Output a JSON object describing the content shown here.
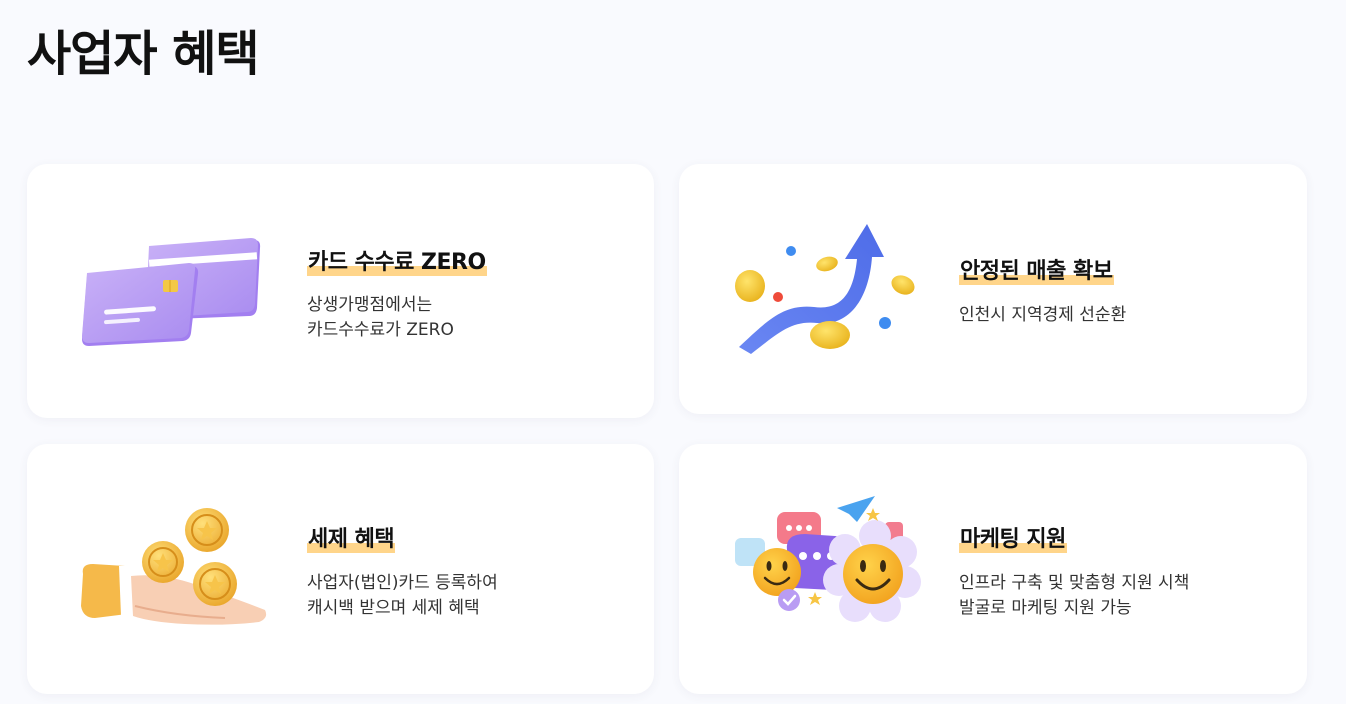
{
  "page": {
    "title": "사업자 혜택"
  },
  "cards": [
    {
      "title": "카드 수수료 ZERO",
      "desc": "상생가맹점에서는\n카드수수료가 ZERO",
      "icon": "credit-card-icon"
    },
    {
      "title": "안정된 매출 확보",
      "desc": "인천시 지역경제 선순환",
      "icon": "growth-arrow-coins-icon"
    },
    {
      "title": "세제 혜택",
      "desc": "사업자(법인)카드 등록하여\n캐시백 받으며 세제 혜택",
      "icon": "hand-coins-icon"
    },
    {
      "title": "마케팅 지원",
      "desc": "인프라 구축 및 맞춤형 지원 시책\n발굴로 마케팅 지원 가능",
      "icon": "smiley-chat-icon"
    }
  ],
  "colors": {
    "highlight": "#ffd58a",
    "card_purple": "#b79cf5",
    "arrow_blue": "#5b7cf0",
    "coin_yellow": "#f7c62f"
  }
}
